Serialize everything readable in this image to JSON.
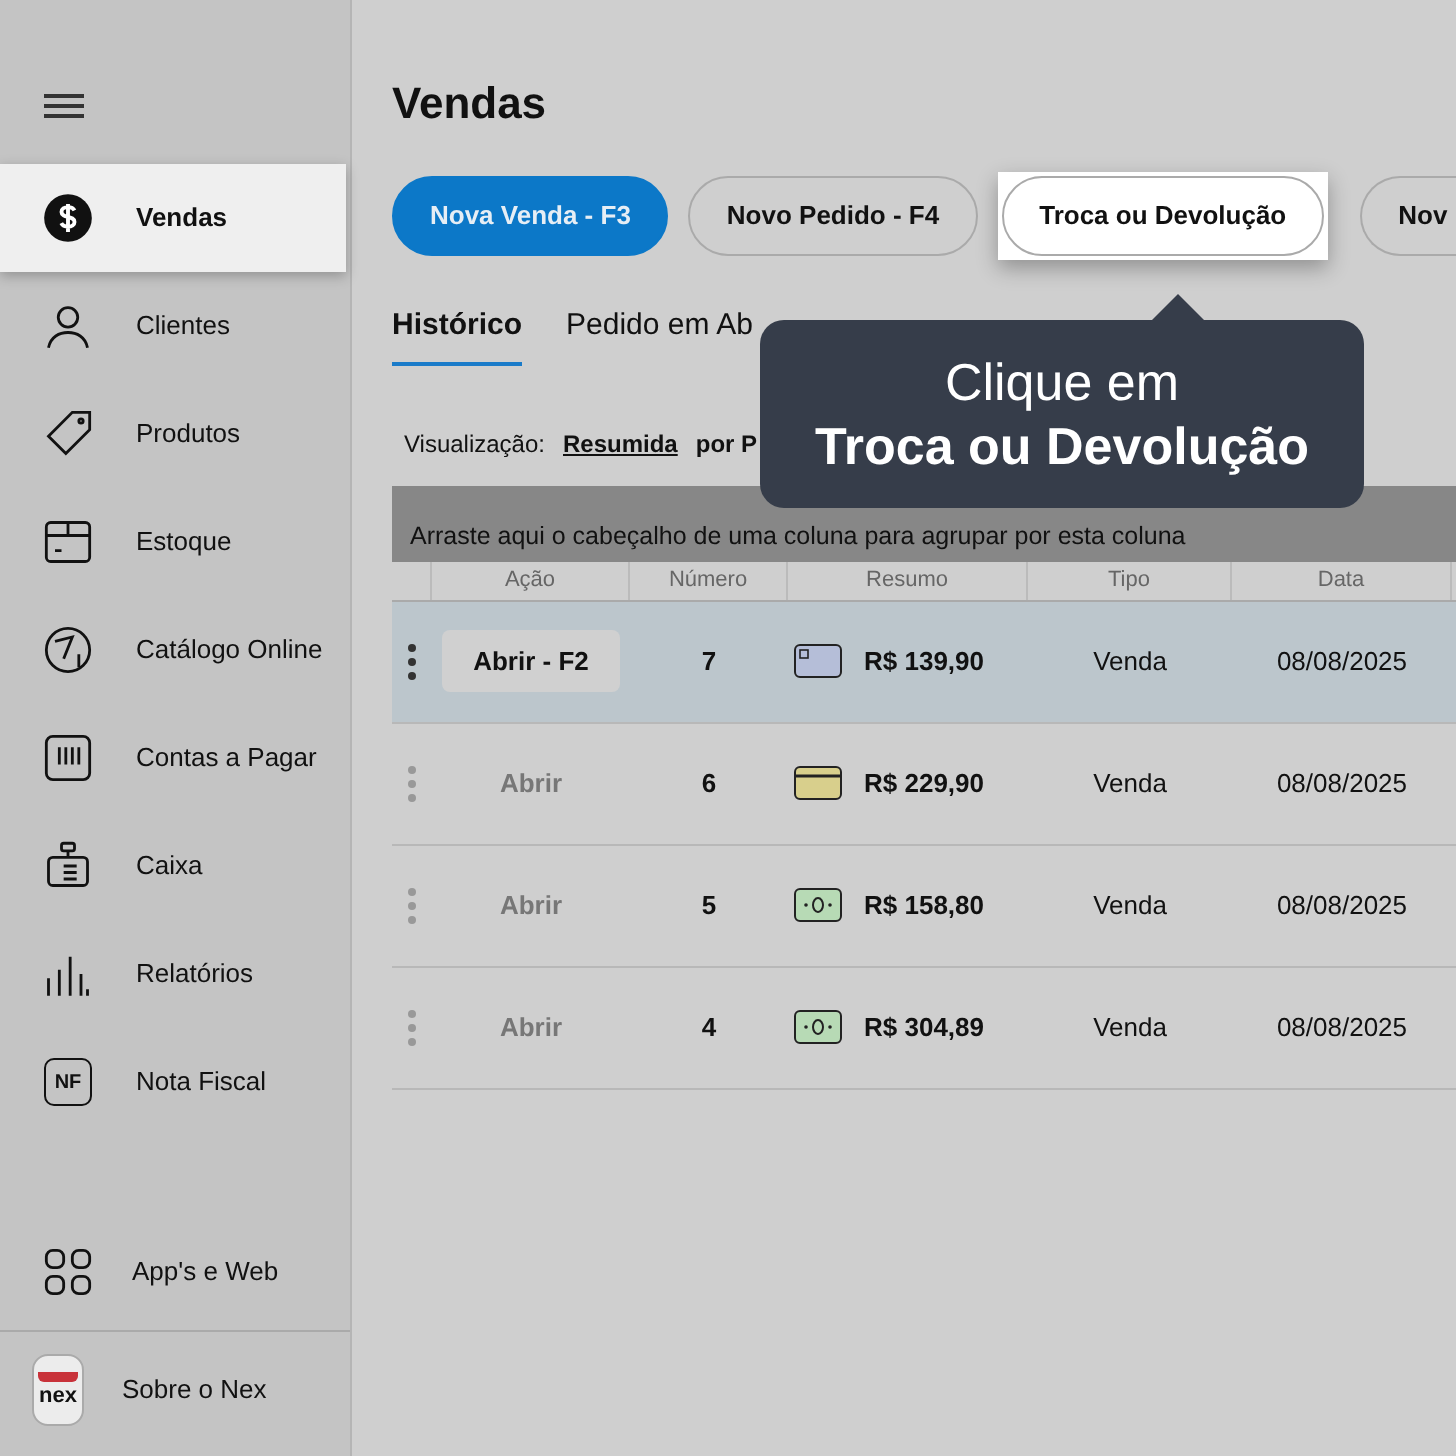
{
  "sidebar": {
    "items": [
      {
        "label": "Vendas",
        "kind": "dollar",
        "selected": true
      },
      {
        "label": "Clientes",
        "kind": "person",
        "selected": false
      },
      {
        "label": "Produtos",
        "kind": "tag",
        "selected": false
      },
      {
        "label": "Estoque",
        "kind": "box",
        "selected": false
      },
      {
        "label": "Catálogo Online",
        "kind": "catalog",
        "selected": false
      },
      {
        "label": "Contas a Pagar",
        "kind": "bills",
        "selected": false
      },
      {
        "label": "Caixa",
        "kind": "register",
        "selected": false
      },
      {
        "label": "Relatórios",
        "kind": "bars",
        "selected": false
      },
      {
        "label": "Nota Fiscal",
        "kind": "nf",
        "icon_text": "NF",
        "selected": false
      }
    ],
    "bottom_items": [
      {
        "label": "App's e Web",
        "kind": "grid"
      },
      {
        "label": "Sobre o Nex",
        "kind": "logo",
        "icon_text": "nex"
      }
    ]
  },
  "page_title": "Vendas",
  "action_buttons": [
    {
      "label": "Nova Venda - F3",
      "kind": "primary",
      "highlighted": false
    },
    {
      "label": "Novo Pedido - F4",
      "kind": "outline",
      "highlighted": false
    },
    {
      "label": "Troca ou Devolução",
      "kind": "outline",
      "highlighted": true
    },
    {
      "label": "Nov",
      "kind": "outline",
      "highlighted": false
    }
  ],
  "tabs": [
    {
      "label": "Histórico",
      "selected": true
    },
    {
      "label": "Pedido em Ab",
      "selected": false
    }
  ],
  "view": {
    "label": "Visualização:",
    "options": [
      {
        "label": "Resumida",
        "selected": true
      },
      {
        "label": "por P",
        "selected": false
      }
    ]
  },
  "tooltip": {
    "line_1": "Clique em",
    "line_2": "Troca ou Devolução"
  },
  "table": {
    "group_hint": "Arraste aqui o cabeçalho de uma coluna para agrupar por esta coluna",
    "columns": [
      "Ação",
      "Número",
      "Resumo",
      "Tipo",
      "Data"
    ],
    "rows": [
      {
        "action": "Abrir - F2",
        "number": "7",
        "kind": "card",
        "total": "R$ 139,90",
        "type": "Venda",
        "date": "08/08/2025",
        "selected": true
      },
      {
        "action": "Abrir",
        "number": "6",
        "kind": "debit",
        "total": "R$ 229,90",
        "type": "Venda",
        "date": "08/08/2025",
        "selected": false
      },
      {
        "action": "Abrir",
        "number": "5",
        "kind": "cash",
        "total": "R$ 158,80",
        "type": "Venda",
        "date": "08/08/2025",
        "selected": false
      },
      {
        "action": "Abrir",
        "number": "4",
        "kind": "cash",
        "total": "R$ 304,89",
        "type": "Venda",
        "date": "08/08/2025",
        "selected": false
      }
    ]
  }
}
